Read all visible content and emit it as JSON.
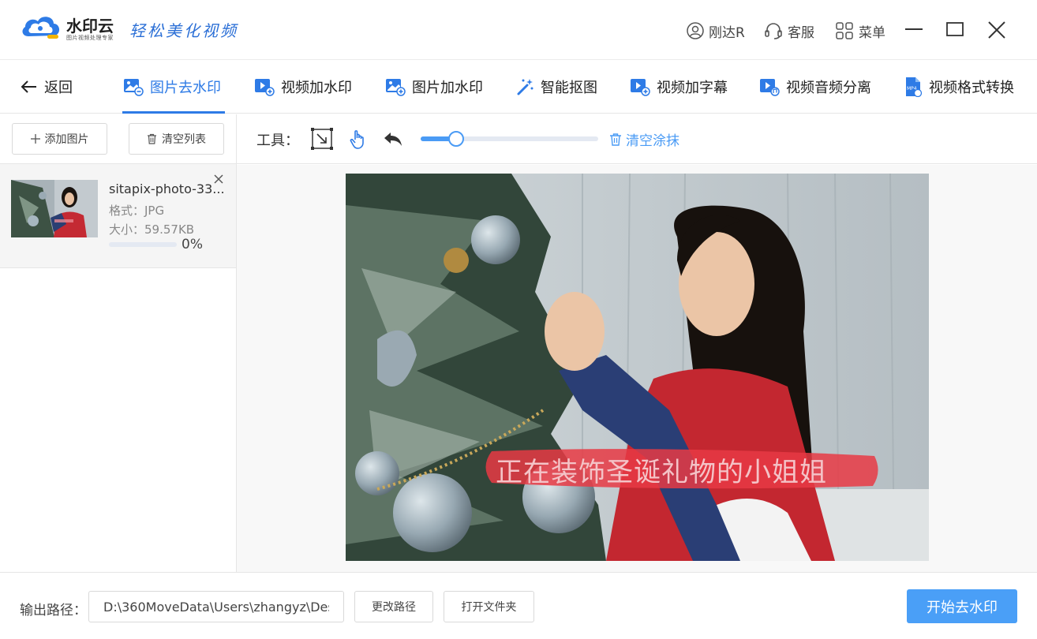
{
  "brand": {
    "name": "水印云",
    "subtitle": "图片视频处理专家",
    "slogan": "轻松美化视频"
  },
  "titlebar": {
    "user": "刚达R",
    "service": "客服",
    "menu": "菜单"
  },
  "nav": {
    "back": "返回",
    "tabs": [
      {
        "label": "图片去水印",
        "active": true
      },
      {
        "label": "视频加水印"
      },
      {
        "label": "图片加水印"
      },
      {
        "label": "智能抠图"
      },
      {
        "label": "视频加字幕"
      },
      {
        "label": "视频音频分离"
      },
      {
        "label": "视频格式转换"
      }
    ]
  },
  "left": {
    "add_label": "添加图片",
    "clear_label": "清空列表",
    "file": {
      "name": "sitapix-photo-33...",
      "format": "格式：JPG",
      "size": "大小：59.57KB",
      "progress_text": "0%",
      "progress": 0
    }
  },
  "toolbar": {
    "label": "工具：",
    "clear_smear": "清空涂抹",
    "brush_level": 0.2
  },
  "canvas": {
    "caption": "正在装饰圣诞礼物的小姐姐"
  },
  "bottom": {
    "output_label": "输出路径：",
    "output_value": "D:\\360MoveData\\Users\\zhangyz\\Des",
    "change_path": "更改路径",
    "open_folder": "打开文件夹",
    "start": "开始去水印"
  },
  "colors": {
    "accent": "#2e7be6",
    "button": "#4a9ff7"
  }
}
